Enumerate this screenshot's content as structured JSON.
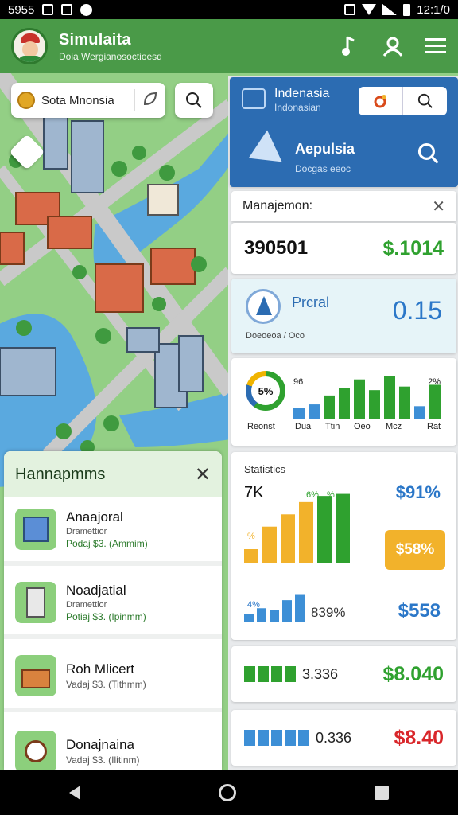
{
  "status_bar": {
    "left": "5955",
    "time": "12:1/0"
  },
  "header": {
    "title": "Simulaita",
    "subtitle": "Doia Wergianosoctioesd"
  },
  "map_search": {
    "value": "Sota Mnonsia"
  },
  "region": {
    "name": "Indenasia",
    "sub": "Indonasian",
    "app_title": "Aepulsia",
    "app_sub": "Docgas eeoc"
  },
  "management": {
    "title": "Manajemon:",
    "population": "390501",
    "population_money": "$.1014",
    "portal_label": "Prcral",
    "portal_sub": "Doeoeoa / Oco",
    "portal_value": "0.15",
    "budget": {
      "ring_label": "5%",
      "pct_left": "96",
      "pct_right": "2%",
      "labels": [
        "Reonst",
        "Dua",
        "Ttin",
        "Oeo",
        "Mcz",
        "Rat"
      ],
      "bars": [
        {
          "value": 12,
          "color": "#3d8fd6"
        },
        {
          "value": 16,
          "color": "#3d8fd6"
        },
        {
          "value": 26,
          "color": "#2fa12f"
        },
        {
          "value": 34,
          "color": "#2fa12f"
        },
        {
          "value": 44,
          "color": "#2fa12f"
        },
        {
          "value": 32,
          "color": "#2fa12f"
        },
        {
          "value": 48,
          "color": "#2fa12f"
        },
        {
          "value": 36,
          "color": "#2fa12f"
        },
        {
          "value": 14,
          "color": "#3d8fd6"
        },
        {
          "value": 38,
          "color": "#2fa12f"
        }
      ]
    }
  },
  "statistics": {
    "title": "Statistics",
    "k": "7K",
    "money1": "$91%",
    "label_a": "6%",
    "label_b": "%",
    "label_c": "%",
    "label_d": "%",
    "badge": "$58%",
    "bars": [
      {
        "value": 14,
        "color": "#f2b22b"
      },
      {
        "value": 36,
        "color": "#f2b22b"
      },
      {
        "value": 48,
        "color": "#f2b22b"
      },
      {
        "value": 60,
        "color": "#f2b22b"
      },
      {
        "value": 66,
        "color": "#2fa12f"
      },
      {
        "value": 68,
        "color": "#2fa12f"
      }
    ],
    "small_label": "4%",
    "small_bars": [
      8,
      14,
      12,
      22,
      28
    ],
    "pct": "839%",
    "money2": "$558"
  },
  "rows": [
    {
      "num": "3.336",
      "money": "$8.040",
      "color": "#2fa12f",
      "money_color": "#2fa12f",
      "segs": 4
    },
    {
      "num": "0.336",
      "money": "$8.40",
      "color": "#3d8fd6",
      "money_color": "#d9262a",
      "segs": 5
    }
  ],
  "left_panel": {
    "title": "Hannapmms",
    "items": [
      {
        "name": "Anaajoral",
        "sub": "Dramettior",
        "meta": "Podaj $3. (Ammim)",
        "meta_color": "green",
        "thumb": "b1"
      },
      {
        "name": "Noadjatial",
        "sub": "Dramettior",
        "meta": "Potiaj $3. (Ipinmm)",
        "meta_color": "green",
        "thumb": "b2"
      },
      {
        "name": "Roh Mlicert",
        "sub": "",
        "meta": "Vadaj $3. (Tithmm)",
        "meta_color": "gray",
        "thumb": "b3"
      },
      {
        "name": "Donajnaina",
        "sub": "",
        "meta": "Vadaj $3. (Ilitinm)",
        "meta_color": "gray",
        "thumb": "b4"
      }
    ]
  },
  "colors": {
    "header_green": "#4a9a48",
    "region_blue": "#2c6cb2",
    "money_green": "#2fa12f",
    "money_blue": "#2b77c8",
    "badge_orange": "#f2b22b",
    "money_red": "#d9262a"
  },
  "icons": [
    "music-note-icon",
    "user-icon",
    "menu-icon",
    "search-icon",
    "leaf-icon",
    "close-icon",
    "plane-icon",
    "back-icon",
    "home-icon",
    "recent-apps-icon"
  ]
}
